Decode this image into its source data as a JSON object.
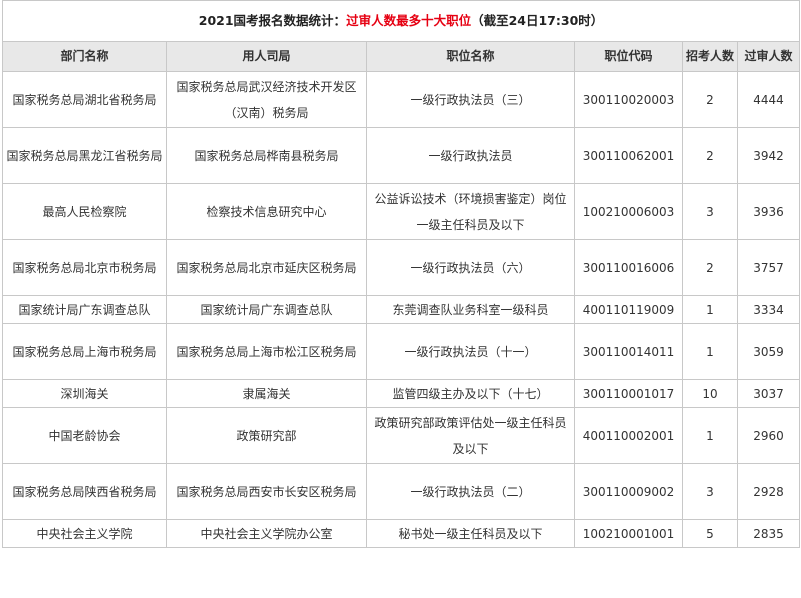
{
  "title": {
    "prefix": "2021国考报名数据统计：",
    "highlight": "过审人数最多十大职位",
    "suffix": "（截至24日17:30时）"
  },
  "colors": {
    "highlight": "#e60012",
    "header_bg": "#e8e8e8",
    "border": "#c8c8c8"
  },
  "columns": [
    "部门名称",
    "用人司局",
    "职位名称",
    "职位代码",
    "招考人数",
    "过审人数"
  ],
  "rows": [
    {
      "dept": "国家税务总局湖北省税务局",
      "bureau": "国家税务总局武汉经济技术开发区（汉南）税务局",
      "position": "一级行政执法员（三）",
      "code": "300110020003",
      "quota": "2",
      "passed": "4444"
    },
    {
      "dept": "国家税务总局黑龙江省税务局",
      "bureau": "国家税务总局桦南县税务局",
      "position": "一级行政执法员",
      "code": "300110062001",
      "quota": "2",
      "passed": "3942"
    },
    {
      "dept": "最高人民检察院",
      "bureau": "检察技术信息研究中心",
      "position": "公益诉讼技术（环境损害鉴定）岗位一级主任科员及以下",
      "code": "100210006003",
      "quota": "3",
      "passed": "3936"
    },
    {
      "dept": "国家税务总局北京市税务局",
      "bureau": "国家税务总局北京市延庆区税务局",
      "position": "一级行政执法员（六）",
      "code": "300110016006",
      "quota": "2",
      "passed": "3757"
    },
    {
      "dept": "国家统计局广东调查总队",
      "bureau": "国家统计局广东调查总队",
      "position": "东莞调查队业务科室一级科员",
      "code": "400110119009",
      "quota": "1",
      "passed": "3334"
    },
    {
      "dept": "国家税务总局上海市税务局",
      "bureau": "国家税务总局上海市松江区税务局",
      "position": "一级行政执法员（十一）",
      "code": "300110014011",
      "quota": "1",
      "passed": "3059"
    },
    {
      "dept": "深圳海关",
      "bureau": "隶属海关",
      "position": "监管四级主办及以下（十七）",
      "code": "300110001017",
      "quota": "10",
      "passed": "3037"
    },
    {
      "dept": "中国老龄协会",
      "bureau": "政策研究部",
      "position": "政策研究部政策评估处一级主任科员及以下",
      "code": "400110002001",
      "quota": "1",
      "passed": "2960"
    },
    {
      "dept": "国家税务总局陕西省税务局",
      "bureau": "国家税务总局西安市长安区税务局",
      "position": "一级行政执法员（二）",
      "code": "300110009002",
      "quota": "3",
      "passed": "2928"
    },
    {
      "dept": "中央社会主义学院",
      "bureau": "中央社会主义学院办公室",
      "position": "秘书处一级主任科员及以下",
      "code": "100210001001",
      "quota": "5",
      "passed": "2835"
    }
  ]
}
